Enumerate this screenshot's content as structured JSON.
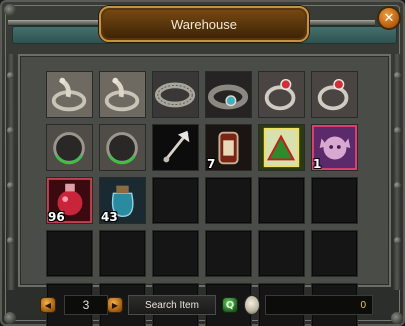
{
  "window": {
    "title": "Warehouse",
    "close_glyph": "✕"
  },
  "grid": {
    "rows": 5,
    "columns": 6,
    "slots": [
      {
        "item": "grey-dragon-bracelet-icon",
        "qty": ""
      },
      {
        "item": "grey-dragon-bracelet-icon",
        "qty": ""
      },
      {
        "item": "engraved-silver-belt-icon",
        "qty": ""
      },
      {
        "item": "jeweled-belt-icon",
        "qty": ""
      },
      {
        "item": "ruby-silver-ring-icon",
        "qty": ""
      },
      {
        "item": "ruby-silver-ring-icon",
        "qty": ""
      },
      {
        "item": "green-gem-ring-icon",
        "qty": ""
      },
      {
        "item": "green-gem-ring-icon",
        "qty": ""
      },
      {
        "item": "battle-axe-icon",
        "qty": ""
      },
      {
        "item": "scroll-capsule-icon",
        "qty": "7"
      },
      {
        "item": "triangle-rune-card-icon",
        "qty": ""
      },
      {
        "item": "elf-pet-portrait-icon",
        "qty": "1"
      },
      {
        "item": "red-potion-icon",
        "qty": "96"
      },
      {
        "item": "teal-jar-potion-icon",
        "qty": "43"
      },
      {
        "item": "",
        "qty": ""
      },
      {
        "item": "",
        "qty": ""
      },
      {
        "item": "",
        "qty": ""
      },
      {
        "item": "",
        "qty": ""
      },
      {
        "item": "",
        "qty": ""
      },
      {
        "item": "",
        "qty": ""
      },
      {
        "item": "",
        "qty": ""
      },
      {
        "item": "",
        "qty": ""
      },
      {
        "item": "",
        "qty": ""
      },
      {
        "item": "",
        "qty": ""
      },
      {
        "item": "",
        "qty": ""
      },
      {
        "item": "",
        "qty": ""
      },
      {
        "item": "",
        "qty": ""
      },
      {
        "item": "",
        "qty": ""
      },
      {
        "item": "",
        "qty": ""
      },
      {
        "item": "",
        "qty": ""
      }
    ]
  },
  "footer": {
    "prev_glyph": "◀",
    "next_glyph": "▶",
    "page": "3",
    "search_label": "Search Item",
    "quick_search_glyph": "Q",
    "money": "0"
  },
  "colors": {
    "title_plaque": "#7a4a12",
    "title_border": "#c6923e",
    "teal_bar": "#44706c",
    "money_text": "#f0c850",
    "slot_bg": "#141514"
  }
}
